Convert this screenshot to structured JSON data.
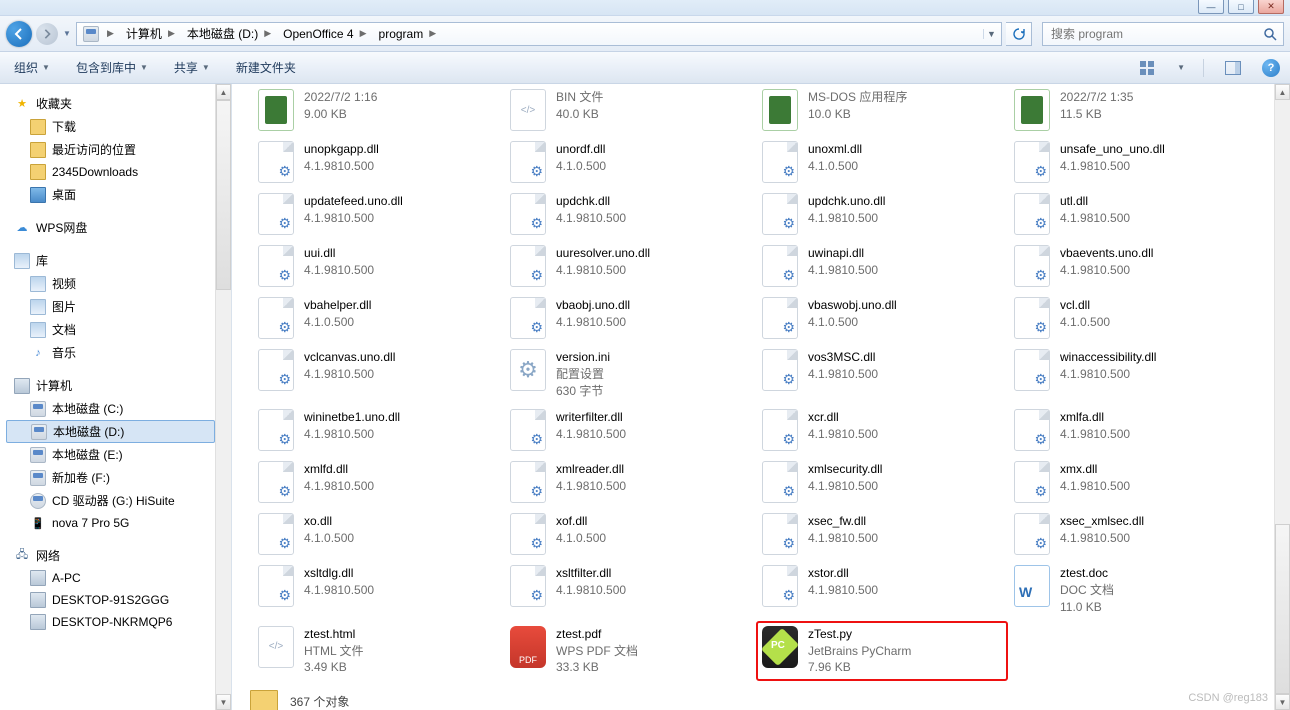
{
  "window_controls": {
    "min": "—",
    "max": "□",
    "close": "✕"
  },
  "breadcrumb": {
    "items": [
      "计算机",
      "本地磁盘 (D:)",
      "OpenOffice 4",
      "program"
    ]
  },
  "search": {
    "placeholder": "搜索 program"
  },
  "toolbar": {
    "organize": "组织",
    "include": "包含到库中",
    "share": "共享",
    "newfolder": "新建文件夹"
  },
  "tree": {
    "favorites": {
      "label": "收藏夹",
      "items": [
        "下载",
        "最近访问的位置",
        "2345Downloads",
        "桌面"
      ]
    },
    "wps": {
      "label": "WPS网盘"
    },
    "libraries": {
      "label": "库",
      "items": [
        "视频",
        "图片",
        "文档",
        "音乐"
      ]
    },
    "computer": {
      "label": "计算机",
      "items": [
        "本地磁盘 (C:)",
        "本地磁盘 (D:)",
        "本地磁盘 (E:)",
        "新加卷 (F:)",
        "CD 驱动器 (G:) HiSuite",
        "nova 7 Pro 5G"
      ]
    },
    "network": {
      "label": "网络",
      "items": [
        "A-PC",
        "DESKTOP-91S2GGG",
        "DESKTOP-NKRMQP6"
      ]
    }
  },
  "files": [
    [
      {
        "name": "",
        "l1": "2022/7/2 1:16",
        "l2": "9.00 KB",
        "icon": "bat"
      },
      {
        "name": "",
        "l1": "BIN 文件",
        "l2": "40.0 KB",
        "icon": "html"
      },
      {
        "name": "",
        "l1": "MS-DOS 应用程序",
        "l2": "10.0 KB",
        "icon": "bat"
      },
      {
        "name": "",
        "l1": "2022/7/2 1:35",
        "l2": "11.5 KB",
        "icon": "bat"
      }
    ],
    [
      {
        "name": "unopkgapp.dll",
        "l1": "4.1.9810.500",
        "l2": "",
        "icon": "dll"
      },
      {
        "name": "unordf.dll",
        "l1": "4.1.0.500",
        "l2": "",
        "icon": "dll"
      },
      {
        "name": "unoxml.dll",
        "l1": "4.1.0.500",
        "l2": "",
        "icon": "dll"
      },
      {
        "name": "unsafe_uno_uno.dll",
        "l1": "4.1.9810.500",
        "l2": "",
        "icon": "dll"
      }
    ],
    [
      {
        "name": "updatefeed.uno.dll",
        "l1": "4.1.9810.500",
        "l2": "",
        "icon": "dll"
      },
      {
        "name": "updchk.dll",
        "l1": "4.1.9810.500",
        "l2": "",
        "icon": "dll"
      },
      {
        "name": "updchk.uno.dll",
        "l1": "4.1.9810.500",
        "l2": "",
        "icon": "dll"
      },
      {
        "name": "utl.dll",
        "l1": "4.1.9810.500",
        "l2": "",
        "icon": "dll"
      }
    ],
    [
      {
        "name": "uui.dll",
        "l1": "4.1.9810.500",
        "l2": "",
        "icon": "dll"
      },
      {
        "name": "uuresolver.uno.dll",
        "l1": "4.1.9810.500",
        "l2": "",
        "icon": "dll"
      },
      {
        "name": "uwinapi.dll",
        "l1": "4.1.9810.500",
        "l2": "",
        "icon": "dll"
      },
      {
        "name": "vbaevents.uno.dll",
        "l1": "4.1.9810.500",
        "l2": "",
        "icon": "dll"
      }
    ],
    [
      {
        "name": "vbahelper.dll",
        "l1": "4.1.0.500",
        "l2": "",
        "icon": "dll"
      },
      {
        "name": "vbaobj.uno.dll",
        "l1": "4.1.9810.500",
        "l2": "",
        "icon": "dll"
      },
      {
        "name": "vbaswobj.uno.dll",
        "l1": "4.1.0.500",
        "l2": "",
        "icon": "dll"
      },
      {
        "name": "vcl.dll",
        "l1": "4.1.0.500",
        "l2": "",
        "icon": "dll"
      }
    ],
    [
      {
        "name": "vclcanvas.uno.dll",
        "l1": "4.1.9810.500",
        "l2": "",
        "icon": "dll"
      },
      {
        "name": "version.ini",
        "l1": "配置设置",
        "l2": "630 字节",
        "icon": "ini"
      },
      {
        "name": "vos3MSC.dll",
        "l1": "4.1.9810.500",
        "l2": "",
        "icon": "dll"
      },
      {
        "name": "winaccessibility.dll",
        "l1": "4.1.9810.500",
        "l2": "",
        "icon": "dll"
      }
    ],
    [
      {
        "name": "wininetbe1.uno.dll",
        "l1": "4.1.9810.500",
        "l2": "",
        "icon": "dll"
      },
      {
        "name": "writerfilter.dll",
        "l1": "4.1.9810.500",
        "l2": "",
        "icon": "dll"
      },
      {
        "name": "xcr.dll",
        "l1": "4.1.9810.500",
        "l2": "",
        "icon": "dll"
      },
      {
        "name": "xmlfa.dll",
        "l1": "4.1.9810.500",
        "l2": "",
        "icon": "dll"
      }
    ],
    [
      {
        "name": "xmlfd.dll",
        "l1": "4.1.9810.500",
        "l2": "",
        "icon": "dll"
      },
      {
        "name": "xmlreader.dll",
        "l1": "4.1.9810.500",
        "l2": "",
        "icon": "dll"
      },
      {
        "name": "xmlsecurity.dll",
        "l1": "4.1.9810.500",
        "l2": "",
        "icon": "dll"
      },
      {
        "name": "xmx.dll",
        "l1": "4.1.9810.500",
        "l2": "",
        "icon": "dll"
      }
    ],
    [
      {
        "name": "xo.dll",
        "l1": "4.1.0.500",
        "l2": "",
        "icon": "dll"
      },
      {
        "name": "xof.dll",
        "l1": "4.1.0.500",
        "l2": "",
        "icon": "dll"
      },
      {
        "name": "xsec_fw.dll",
        "l1": "4.1.9810.500",
        "l2": "",
        "icon": "dll"
      },
      {
        "name": "xsec_xmlsec.dll",
        "l1": "4.1.9810.500",
        "l2": "",
        "icon": "dll"
      }
    ],
    [
      {
        "name": "xsltdlg.dll",
        "l1": "4.1.9810.500",
        "l2": "",
        "icon": "dll"
      },
      {
        "name": "xsltfilter.dll",
        "l1": "4.1.9810.500",
        "l2": "",
        "icon": "dll"
      },
      {
        "name": "xstor.dll",
        "l1": "4.1.9810.500",
        "l2": "",
        "icon": "dll"
      },
      {
        "name": "ztest.doc",
        "l1": "DOC 文档",
        "l2": "11.0 KB",
        "icon": "doc"
      }
    ],
    [
      {
        "name": "ztest.html",
        "l1": "HTML 文件",
        "l2": "3.49 KB",
        "icon": "html"
      },
      {
        "name": "ztest.pdf",
        "l1": "WPS PDF 文档",
        "l2": "33.3 KB",
        "icon": "pdf"
      },
      {
        "name": "zTest.py",
        "l1": "JetBrains PyCharm",
        "l2": "7.96 KB",
        "icon": "py",
        "highlight": true
      },
      {
        "name": "",
        "l1": "",
        "l2": "",
        "icon": "",
        "empty": true
      }
    ]
  ],
  "status": {
    "count": "367 个对象"
  },
  "watermark": "CSDN @reg183"
}
